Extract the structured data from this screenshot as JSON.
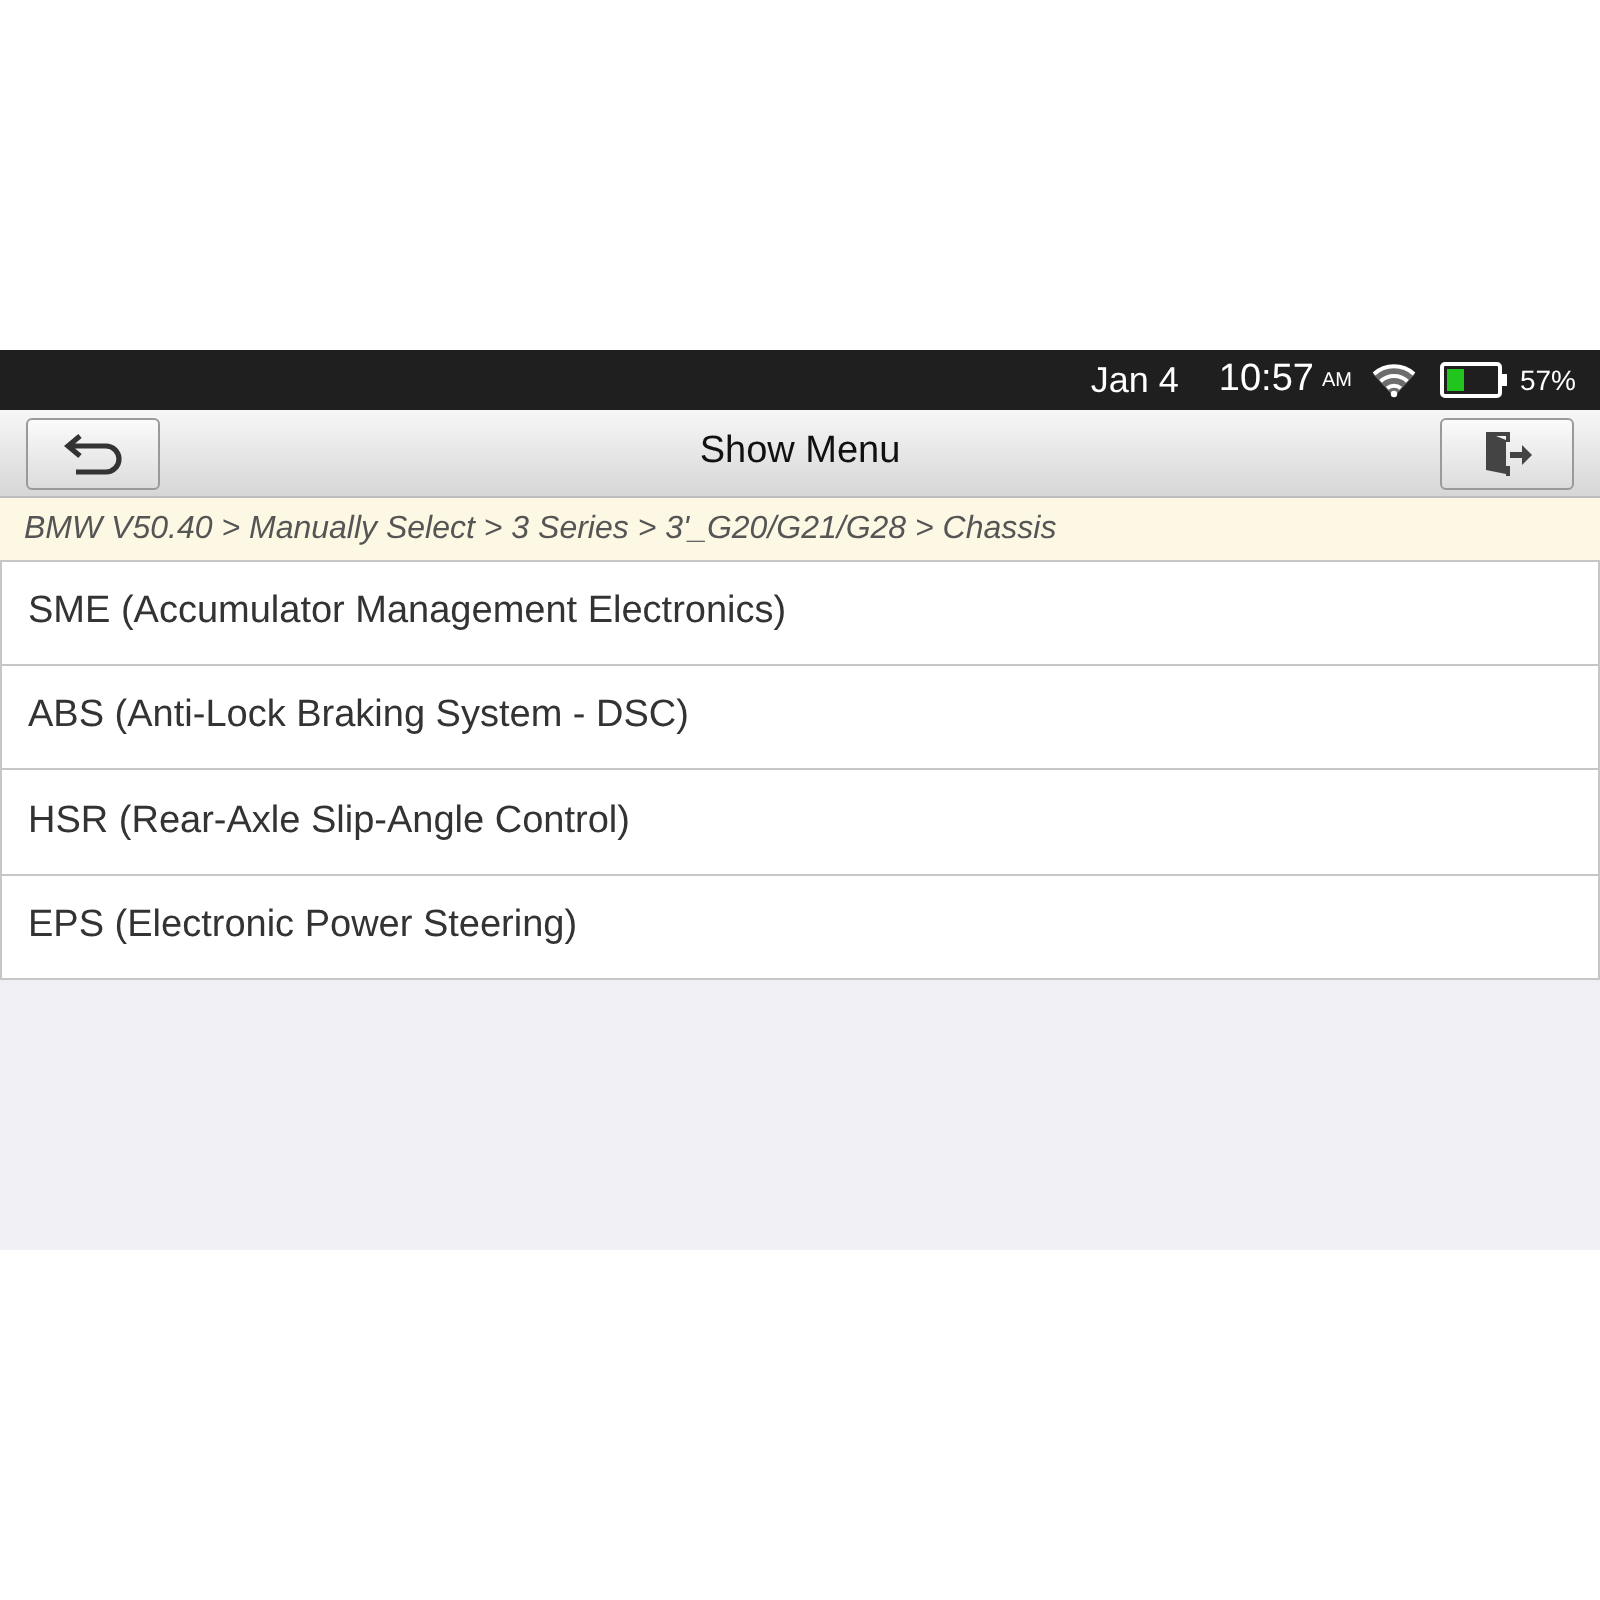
{
  "status_bar": {
    "date": "Jan 4",
    "time": "10:57",
    "meridiem": "AM",
    "battery_percent": "57%"
  },
  "header": {
    "title": "Show Menu"
  },
  "breadcrumb": "BMW V50.40 > Manually Select > 3 Series > 3'_G20/G21/G28 > Chassis",
  "menu_items": [
    "SME (Accumulator Management Electronics)",
    "ABS (Anti-Lock Braking System - DSC)",
    "HSR (Rear-Axle Slip-Angle Control)",
    "EPS (Electronic Power Steering)"
  ]
}
